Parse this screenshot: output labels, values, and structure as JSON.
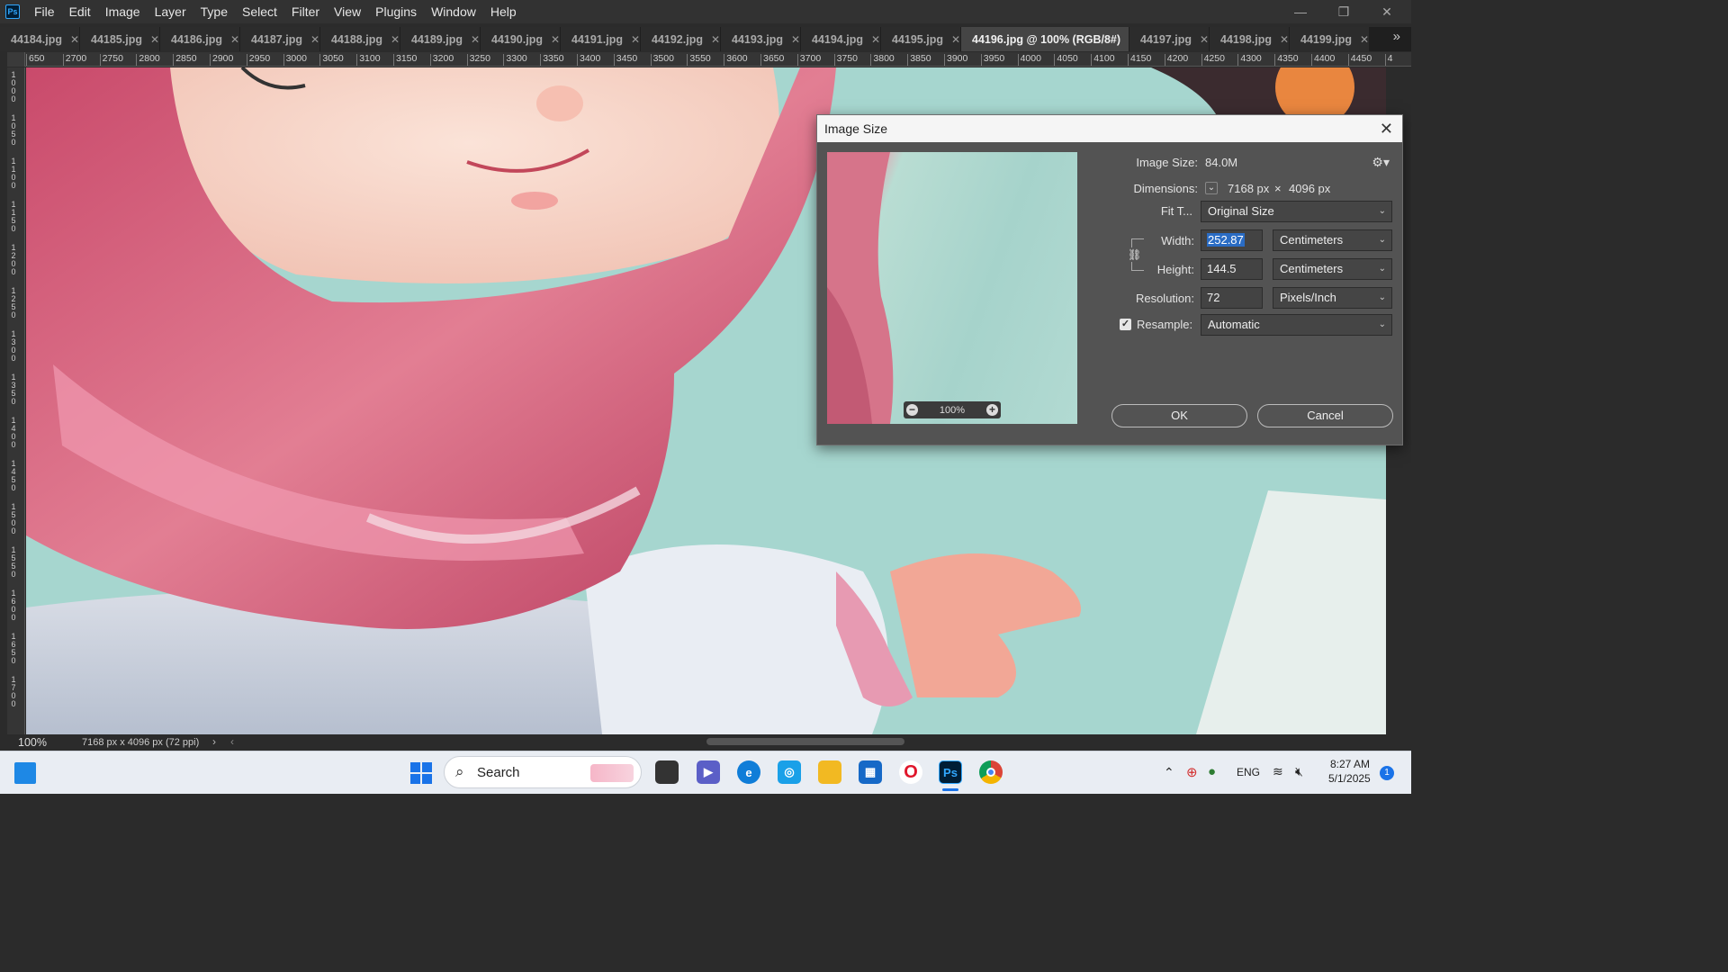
{
  "app": {
    "logo": "Ps",
    "menu": [
      "File",
      "Edit",
      "Image",
      "Layer",
      "Type",
      "Select",
      "Filter",
      "View",
      "Plugins",
      "Window",
      "Help"
    ]
  },
  "tabs": [
    {
      "label": "44184.jpg",
      "active": false
    },
    {
      "label": "44185.jpg",
      "active": false
    },
    {
      "label": "44186.jpg",
      "active": false
    },
    {
      "label": "44187.jpg",
      "active": false
    },
    {
      "label": "44188.jpg",
      "active": false
    },
    {
      "label": "44189.jpg",
      "active": false
    },
    {
      "label": "44190.jpg",
      "active": false
    },
    {
      "label": "44191.jpg",
      "active": false
    },
    {
      "label": "44192.jpg",
      "active": false
    },
    {
      "label": "44193.jpg",
      "active": false
    },
    {
      "label": "44194.jpg",
      "active": false
    },
    {
      "label": "44195.jpg",
      "active": false
    },
    {
      "label": "44196.jpg @ 100% (RGB/8#)",
      "active": true
    },
    {
      "label": "44197.jpg",
      "active": false
    },
    {
      "label": "44198.jpg",
      "active": false
    },
    {
      "label": "44199.jpg",
      "active": false
    }
  ],
  "ruler": {
    "h_ticks": [
      "650",
      "2700",
      "2750",
      "2800",
      "2850",
      "2900",
      "2950",
      "3000",
      "3050",
      "3100",
      "3150",
      "3200",
      "3250",
      "3300",
      "3350",
      "3400",
      "3450",
      "3500",
      "3550",
      "3600",
      "3650",
      "3700",
      "3750",
      "3800",
      "3850",
      "3900",
      "3950",
      "4000",
      "4050",
      "4100",
      "4150",
      "4200",
      "4250",
      "4300",
      "4350",
      "4400",
      "4450",
      "4"
    ],
    "v_ticks": [
      "1000",
      "1050",
      "1100",
      "1150",
      "1200",
      "1250",
      "1300",
      "1350",
      "1400",
      "1450",
      "1500",
      "1550",
      "1600",
      "1650",
      "1700"
    ]
  },
  "status": {
    "zoom": "100%",
    "doc_info": "7168 px x 4096 px (72 ppi)"
  },
  "dialog": {
    "title": "Image Size",
    "image_size_label": "Image Size:",
    "image_size_value": "84.0M",
    "dimensions_label": "Dimensions:",
    "dim_width": "7168 px",
    "dim_sep": "×",
    "dim_height": "4096 px",
    "fit_label": "Fit T...",
    "fit_value": "Original Size",
    "width_label": "Width:",
    "width_value": "252.87",
    "width_unit": "Centimeters",
    "height_label": "Height:",
    "height_value": "144.5",
    "height_unit": "Centimeters",
    "resolution_label": "Resolution:",
    "resolution_value": "72",
    "resolution_unit": "Pixels/Inch",
    "resample_label": "Resample:",
    "resample_value": "Automatic",
    "resample_checked": true,
    "preview_zoom": "100%",
    "ok_label": "OK",
    "cancel_label": "Cancel"
  },
  "taskbar": {
    "search_placeholder": "Search",
    "language": "ENG",
    "time": "8:27 AM",
    "date": "5/1/2025",
    "notification_count": "1",
    "pinned": [
      "start",
      "search",
      "file-explorer",
      "teams",
      "edge",
      "copilot",
      "folder",
      "store",
      "opera",
      "photoshop",
      "chrome"
    ]
  }
}
